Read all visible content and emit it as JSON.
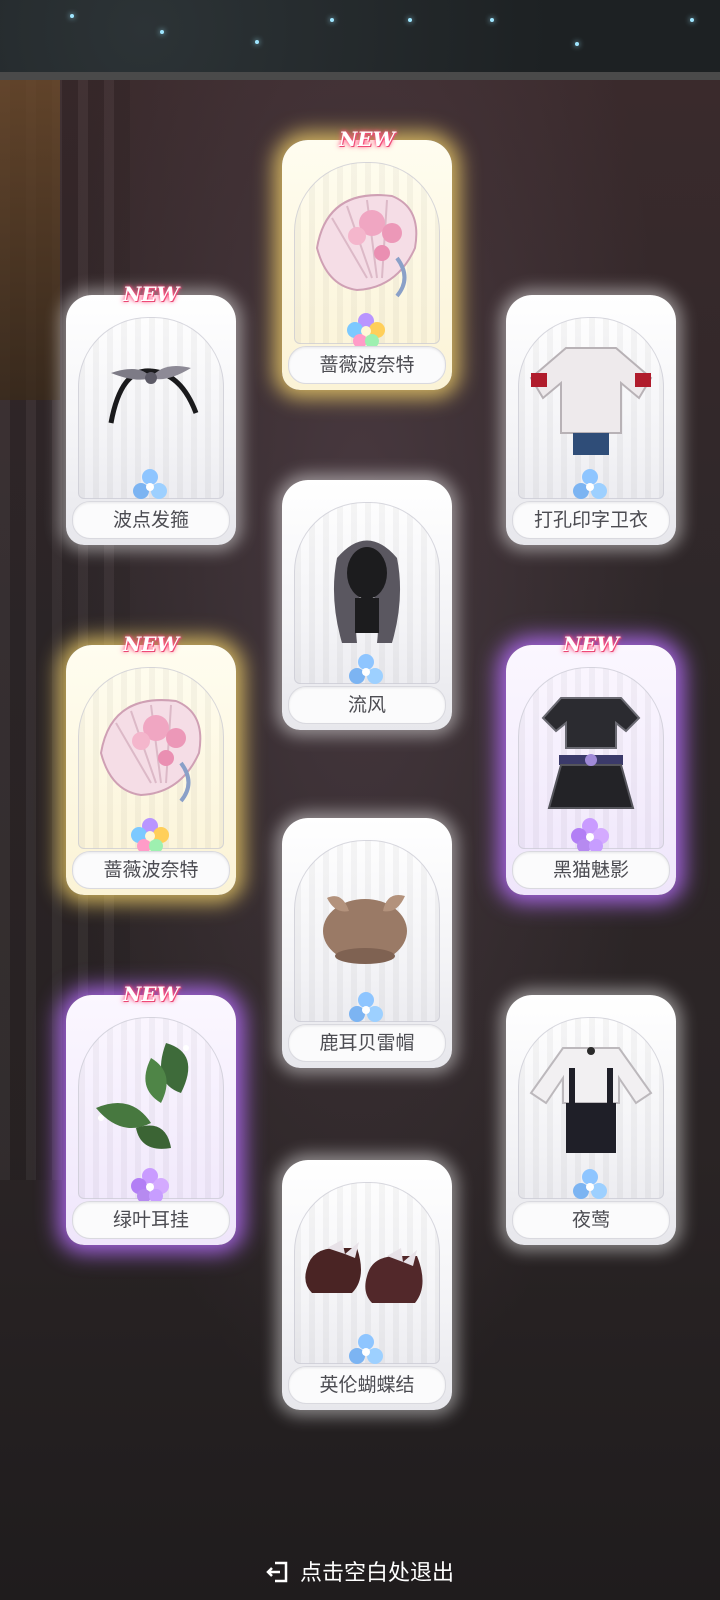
{
  "exit_hint": "点击空白处退出",
  "colors": {
    "gold_glow": "#ffdc6e",
    "purple_glow": "#b96eff",
    "white_glow": "#ffffff",
    "new_tag": "#ff3b76"
  },
  "cards": [
    {
      "name": "蔷薇波奈特",
      "new_label": "NEW",
      "rarity": "rainbow-flower",
      "item_icon": "rose-fan-headpiece-icon",
      "glow": "gold"
    },
    {
      "name": "波点发箍",
      "new_label": "NEW",
      "rarity": "blue-flower",
      "item_icon": "headband-icon",
      "glow": "white"
    },
    {
      "name": "打孔印字卫衣",
      "new_label": "",
      "rarity": "blue-flower",
      "item_icon": "sweatshirt-icon",
      "glow": "white"
    },
    {
      "name": "流风",
      "new_label": "",
      "rarity": "blue-flower",
      "item_icon": "hair-icon",
      "glow": "white"
    },
    {
      "name": "蔷薇波奈特",
      "new_label": "NEW",
      "rarity": "rainbow-flower",
      "item_icon": "rose-fan-headpiece-icon",
      "glow": "gold"
    },
    {
      "name": "黑猫魅影",
      "new_label": "NEW",
      "rarity": "purple-flower",
      "item_icon": "black-outfit-icon",
      "glow": "purple"
    },
    {
      "name": "鹿耳贝雷帽",
      "new_label": "",
      "rarity": "blue-flower",
      "item_icon": "beret-icon",
      "glow": "white"
    },
    {
      "name": "绿叶耳挂",
      "new_label": "NEW",
      "rarity": "purple-flower",
      "item_icon": "leaf-earring-icon",
      "glow": "purple"
    },
    {
      "name": "夜莺",
      "new_label": "",
      "rarity": "blue-flower",
      "item_icon": "overall-dress-icon",
      "glow": "white"
    },
    {
      "name": "英伦蝴蝶结",
      "new_label": "",
      "rarity": "blue-flower",
      "item_icon": "bow-shoes-icon",
      "glow": "white"
    }
  ]
}
